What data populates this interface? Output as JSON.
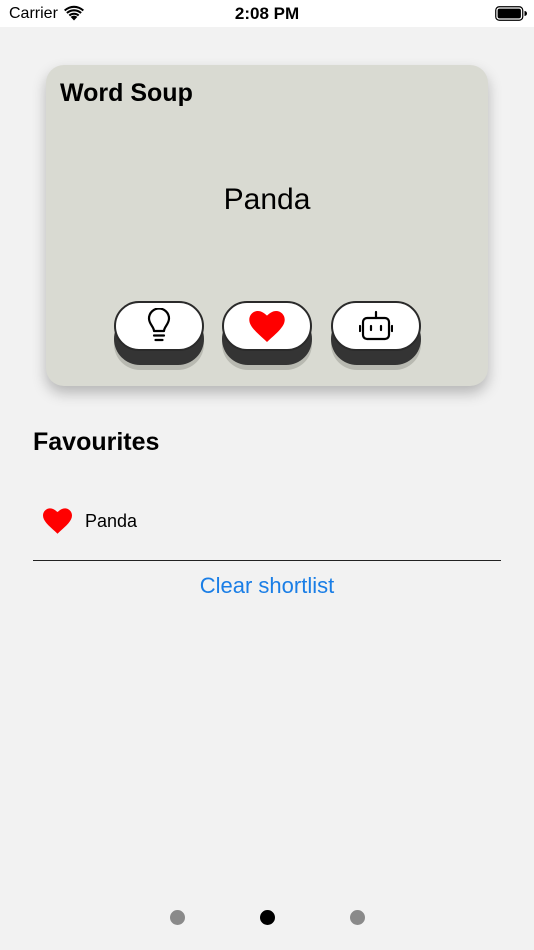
{
  "status_bar": {
    "carrier": "Carrier",
    "time": "2:08 PM",
    "icons": [
      "wifi-icon",
      "battery-icon"
    ]
  },
  "card": {
    "title": "Word Soup",
    "word": "Panda",
    "background": "#d9dad2",
    "buttons": [
      {
        "icon": "lightbulb-icon"
      },
      {
        "icon": "heart-icon",
        "color": "#ff0000"
      },
      {
        "icon": "robot-icon"
      }
    ]
  },
  "favourites": {
    "heading": "Favourites",
    "items": [
      {
        "label": "Panda",
        "icon": "heart-icon"
      }
    ],
    "clear_label": "Clear shortlist",
    "link_color": "#1a7ee6"
  },
  "pager": {
    "page_count": 3,
    "current_page": 2
  }
}
